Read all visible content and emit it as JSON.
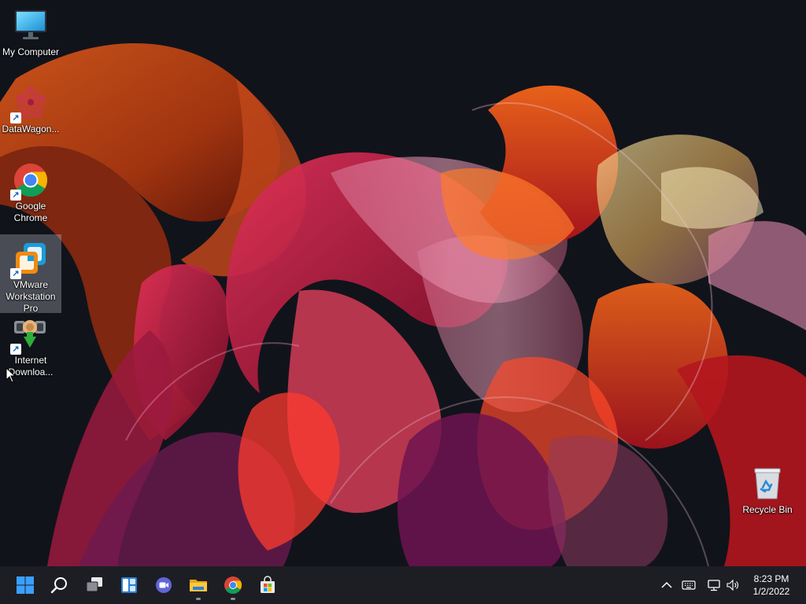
{
  "desktop": {
    "icons": [
      {
        "label": "My Computer",
        "icon": "monitor-icon"
      },
      {
        "label": "DataWagon...",
        "icon": "datawagon-icon"
      },
      {
        "label": "Google Chrome",
        "icon": "chrome-icon"
      },
      {
        "label": "VMware Workstation Pro",
        "icon": "vmware-icon"
      },
      {
        "label": "Internet Downloa...",
        "icon": "internet-download-manager-icon"
      }
    ],
    "recycle_bin": {
      "label": "Recycle Bin",
      "icon": "recycle-bin-icon"
    }
  },
  "taskbar": {
    "apps": [
      "start-icon",
      "search-icon",
      "task-view-icon",
      "widgets-icon",
      "teams-chat-icon",
      "file-explorer-icon",
      "chrome-icon",
      "microsoft-store-icon"
    ],
    "tray": [
      "chevron-up-icon",
      "keyboard-icon",
      "network-icon",
      "volume-icon"
    ],
    "clock": {
      "time": "8:23 PM",
      "date": "1/2/2022"
    }
  },
  "colors": {
    "taskbar_bg": "#1d1e24",
    "accent_blue": "#3aa0ff",
    "wallpaper_bg": "#11131b"
  }
}
